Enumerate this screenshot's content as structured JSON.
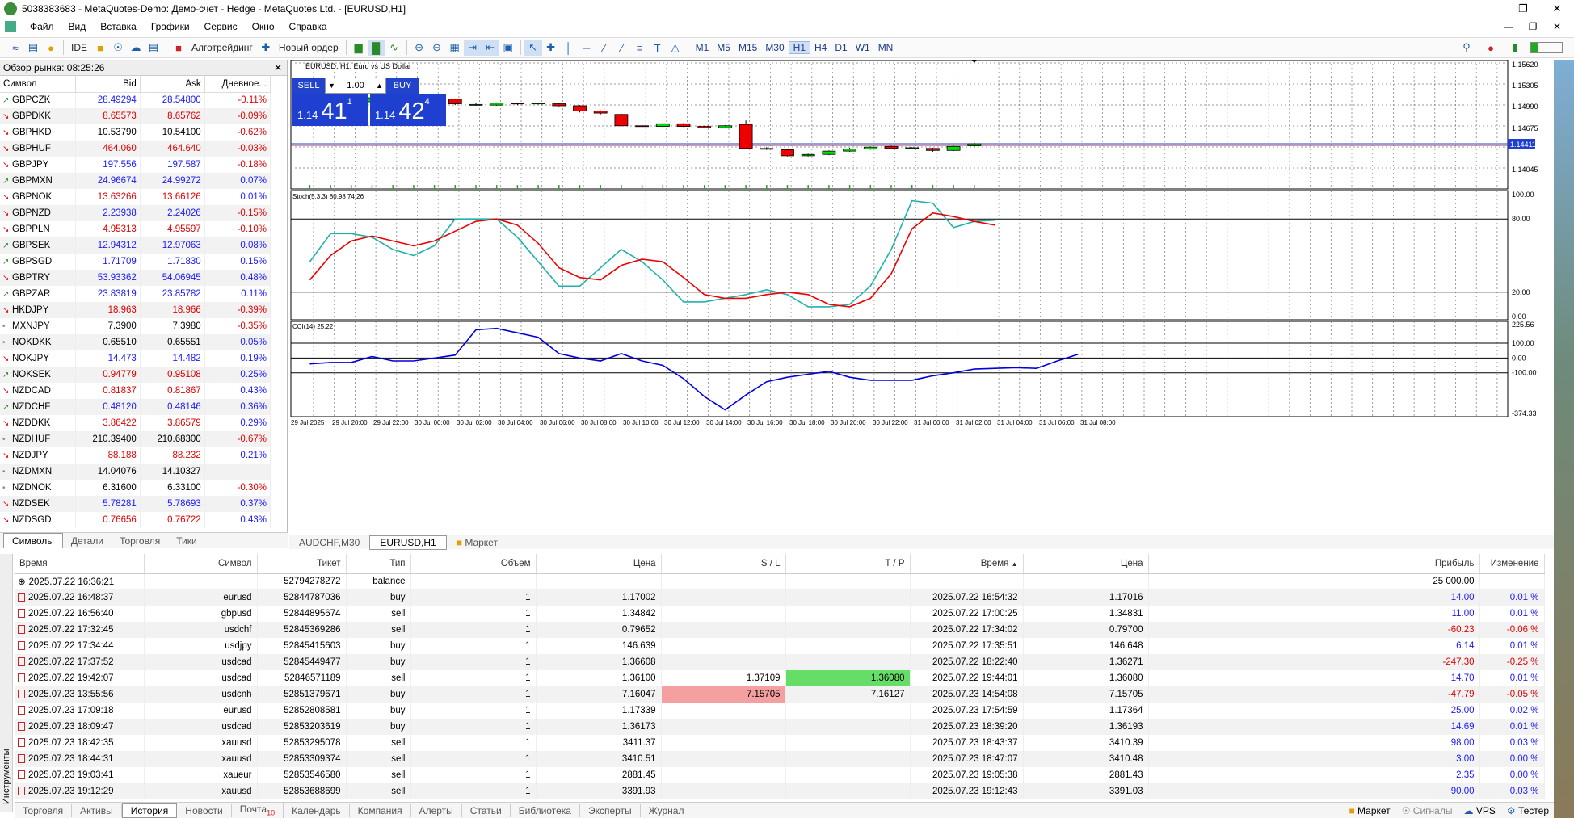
{
  "window": {
    "title": "5038383683 - MetaQuotes-Demo: Демо-счет - Hedge - MetaQuotes Ltd. - [EURUSD,H1]"
  },
  "menu": [
    "Файл",
    "Вид",
    "Вставка",
    "Графики",
    "Сервис",
    "Окно",
    "Справка"
  ],
  "toolbar": {
    "ide": "IDE",
    "algo": "Алготрейдинг",
    "new_order": "Новый ордер",
    "timeframes": [
      "M1",
      "M5",
      "M15",
      "M30",
      "H1",
      "H4",
      "D1",
      "W1",
      "MN"
    ],
    "active_tf": "H1"
  },
  "market_watch": {
    "title": "Обзор рынка: 08:25:26",
    "headers": [
      "Символ",
      "Bid",
      "Ask",
      "Дневное..."
    ],
    "rows": [
      {
        "s": "GBPCZK",
        "b": "28.49294",
        "a": "28.54800",
        "c": "-0.11%",
        "d": "up",
        "cd": "dn",
        "pc": "up"
      },
      {
        "s": "GBPDKK",
        "b": "8.65573",
        "a": "8.65762",
        "c": "-0.09%",
        "d": "dn",
        "cd": "dn",
        "pc": "dn"
      },
      {
        "s": "GBPHKD",
        "b": "10.53790",
        "a": "10.54100",
        "c": "-0.62%",
        "d": "dn",
        "cd": "dn",
        "pc": "neutral"
      },
      {
        "s": "GBPHUF",
        "b": "464.060",
        "a": "464.640",
        "c": "-0.03%",
        "d": "dn",
        "cd": "dn",
        "pc": "dn"
      },
      {
        "s": "GBPJPY",
        "b": "197.556",
        "a": "197.587",
        "c": "-0.18%",
        "d": "dn",
        "cd": "dn",
        "pc": "up"
      },
      {
        "s": "GBPMXN",
        "b": "24.96674",
        "a": "24.99272",
        "c": "0.07%",
        "d": "up",
        "cd": "up",
        "pc": "up"
      },
      {
        "s": "GBPNOK",
        "b": "13.63266",
        "a": "13.66126",
        "c": "0.01%",
        "d": "dn",
        "cd": "up",
        "pc": "dn"
      },
      {
        "s": "GBPNZD",
        "b": "2.23938",
        "a": "2.24026",
        "c": "-0.15%",
        "d": "dn",
        "cd": "dn",
        "pc": "up"
      },
      {
        "s": "GBPPLN",
        "b": "4.95313",
        "a": "4.95597",
        "c": "-0.10%",
        "d": "dn",
        "cd": "dn",
        "pc": "dn"
      },
      {
        "s": "GBPSEK",
        "b": "12.94312",
        "a": "12.97063",
        "c": "0.08%",
        "d": "up",
        "cd": "up",
        "pc": "up"
      },
      {
        "s": "GBPSGD",
        "b": "1.71709",
        "a": "1.71830",
        "c": "0.15%",
        "d": "up",
        "cd": "up",
        "pc": "up"
      },
      {
        "s": "GBPTRY",
        "b": "53.93362",
        "a": "54.06945",
        "c": "0.48%",
        "d": "dn",
        "cd": "up",
        "pc": "up"
      },
      {
        "s": "GBPZAR",
        "b": "23.83819",
        "a": "23.85782",
        "c": "0.11%",
        "d": "up",
        "cd": "up",
        "pc": "up"
      },
      {
        "s": "HKDJPY",
        "b": "18.963",
        "a": "18.966",
        "c": "-0.39%",
        "d": "dn",
        "cd": "dn",
        "pc": "dn"
      },
      {
        "s": "MXNJPY",
        "b": "7.3900",
        "a": "7.3980",
        "c": "-0.35%",
        "d": "none",
        "cd": "dn",
        "pc": "neutral"
      },
      {
        "s": "NOKDKK",
        "b": "0.65510",
        "a": "0.65551",
        "c": "0.05%",
        "d": "none",
        "cd": "up",
        "pc": "neutral"
      },
      {
        "s": "NOKJPY",
        "b": "14.473",
        "a": "14.482",
        "c": "0.19%",
        "d": "dn",
        "cd": "up",
        "pc": "up"
      },
      {
        "s": "NOKSEK",
        "b": "0.94779",
        "a": "0.95108",
        "c": "0.25%",
        "d": "up",
        "cd": "up",
        "pc": "dn"
      },
      {
        "s": "NZDCAD",
        "b": "0.81837",
        "a": "0.81867",
        "c": "0.43%",
        "d": "dn",
        "cd": "up",
        "pc": "dn"
      },
      {
        "s": "NZDCHF",
        "b": "0.48120",
        "a": "0.48146",
        "c": "0.36%",
        "d": "up",
        "cd": "up",
        "pc": "up"
      },
      {
        "s": "NZDDKK",
        "b": "3.86422",
        "a": "3.86579",
        "c": "0.29%",
        "d": "dn",
        "cd": "up",
        "pc": "dn"
      },
      {
        "s": "NZDHUF",
        "b": "210.39400",
        "a": "210.68300",
        "c": "-0.67%",
        "d": "none",
        "cd": "dn",
        "pc": "neutral"
      },
      {
        "s": "NZDJPY",
        "b": "88.188",
        "a": "88.232",
        "c": "0.21%",
        "d": "dn",
        "cd": "up",
        "pc": "dn"
      },
      {
        "s": "NZDMXN",
        "b": "14.04076",
        "a": "14.10327",
        "c": "",
        "d": "none",
        "cd": "up",
        "pc": "neutral"
      },
      {
        "s": "NZDNOK",
        "b": "6.31600",
        "a": "6.33100",
        "c": "-0.30%",
        "d": "none",
        "cd": "dn",
        "pc": "neutral"
      },
      {
        "s": "NZDSEK",
        "b": "5.78281",
        "a": "5.78693",
        "c": "0.37%",
        "d": "dn",
        "cd": "up",
        "pc": "up"
      },
      {
        "s": "NZDSGD",
        "b": "0.76656",
        "a": "0.76722",
        "c": "0.43%",
        "d": "dn",
        "cd": "up",
        "pc": "dn"
      }
    ],
    "tabs": [
      "Символы",
      "Детали",
      "Торговля",
      "Тики"
    ]
  },
  "chart": {
    "title": "EURUSD, H1:  Euro vs US Dollar",
    "sell": "SELL",
    "buy": "BUY",
    "volume": "1.00",
    "sell_price": {
      "small": "1.14",
      "big": "41",
      "sup": "1"
    },
    "buy_price": {
      "small": "1.14",
      "big": "42",
      "sup": "4"
    },
    "price_axis": [
      "1.15620",
      "1.15305",
      "1.14990",
      "1.14675",
      "1.14411",
      "1.14045"
    ],
    "stoch_label": "Stoch(5,3,3) 80.98 74.26",
    "stoch_axis": [
      "100.00",
      "80.00",
      "20.00",
      "0.00"
    ],
    "cci_label": "CCI(14) 25.22",
    "cci_axis": [
      "225.56",
      "100.00",
      "0.00",
      "-100.00",
      "-374.33"
    ],
    "time_axis": [
      "29 Jul 2025",
      "29 Jul 20:00",
      "29 Jul 22:00",
      "30 Jul 00:00",
      "30 Jul 02:00",
      "30 Jul 04:00",
      "30 Jul 06:00",
      "30 Jul 08:00",
      "30 Jul 10:00",
      "30 Jul 12:00",
      "30 Jul 14:00",
      "30 Jul 16:00",
      "30 Jul 18:00",
      "30 Jul 20:00",
      "30 Jul 22:00",
      "31 Jul 00:00",
      "31 Jul 02:00",
      "31 Jul 04:00",
      "31 Jul 06:00",
      "31 Jul 08:00"
    ],
    "tabs": [
      "AUDCHF,M30",
      "EURUSD,H1",
      "Маркет"
    ]
  },
  "history": {
    "headers": [
      "Время",
      "Символ",
      "Тикет",
      "Тип",
      "Объем",
      "Цена",
      "S / L",
      "T / P",
      "Время",
      "Цена",
      "Прибыль",
      "Изменение"
    ],
    "rows": [
      {
        "t": "2025.07.22 16:36:21",
        "s": "",
        "k": "52794278272",
        "ty": "balance",
        "v": "",
        "p": "",
        "sl": "",
        "tp": "",
        "t2": "",
        "p2": "",
        "pr": "25 000.00",
        "ch": "",
        "bal": true
      },
      {
        "t": "2025.07.22 16:48:37",
        "s": "eurusd",
        "k": "52844787036",
        "ty": "buy",
        "v": "1",
        "p": "1.17002",
        "sl": "",
        "tp": "",
        "t2": "2025.07.22 16:54:32",
        "p2": "1.17016",
        "pr": "14.00",
        "ch": "0.01 %"
      },
      {
        "t": "2025.07.22 16:56:40",
        "s": "gbpusd",
        "k": "52844895674",
        "ty": "sell",
        "v": "1",
        "p": "1.34842",
        "sl": "",
        "tp": "",
        "t2": "2025.07.22 17:00:25",
        "p2": "1.34831",
        "pr": "11.00",
        "ch": "0.01 %"
      },
      {
        "t": "2025.07.22 17:32:45",
        "s": "usdchf",
        "k": "52845369286",
        "ty": "sell",
        "v": "1",
        "p": "0.79652",
        "sl": "",
        "tp": "",
        "t2": "2025.07.22 17:34:02",
        "p2": "0.79700",
        "pr": "-60.23",
        "ch": "-0.06 %"
      },
      {
        "t": "2025.07.22 17:34:44",
        "s": "usdjpy",
        "k": "52845415603",
        "ty": "buy",
        "v": "1",
        "p": "146.639",
        "sl": "",
        "tp": "",
        "t2": "2025.07.22 17:35:51",
        "p2": "146.648",
        "pr": "6.14",
        "ch": "0.01 %"
      },
      {
        "t": "2025.07.22 17:37:52",
        "s": "usdcad",
        "k": "52845449477",
        "ty": "buy",
        "v": "1",
        "p": "1.36608",
        "sl": "",
        "tp": "",
        "t2": "2025.07.22 18:22:40",
        "p2": "1.36271",
        "pr": "-247.30",
        "ch": "-0.25 %"
      },
      {
        "t": "2025.07.22 19:42:07",
        "s": "usdcad",
        "k": "52846571189",
        "ty": "sell",
        "v": "1",
        "p": "1.36100",
        "sl": "1.37109",
        "tp": "1.36080",
        "t2": "2025.07.22 19:44:01",
        "p2": "1.36080",
        "pr": "14.70",
        "ch": "0.01 %",
        "tpg": true
      },
      {
        "t": "2025.07.23 13:55:56",
        "s": "usdcnh",
        "k": "52851379671",
        "ty": "buy",
        "v": "1",
        "p": "7.16047",
        "sl": "7.15705",
        "tp": "7.16127",
        "t2": "2025.07.23 14:54:08",
        "p2": "7.15705",
        "pr": "-47.79",
        "ch": "-0.05 %",
        "slr": true
      },
      {
        "t": "2025.07.23 17:09:18",
        "s": "eurusd",
        "k": "52852808581",
        "ty": "buy",
        "v": "1",
        "p": "1.17339",
        "sl": "",
        "tp": "",
        "t2": "2025.07.23 17:54:59",
        "p2": "1.17364",
        "pr": "25.00",
        "ch": "0.02 %"
      },
      {
        "t": "2025.07.23 18:09:47",
        "s": "usdcad",
        "k": "52853203619",
        "ty": "buy",
        "v": "1",
        "p": "1.36173",
        "sl": "",
        "tp": "",
        "t2": "2025.07.23 18:39:20",
        "p2": "1.36193",
        "pr": "14.69",
        "ch": "0.01 %"
      },
      {
        "t": "2025.07.23 18:42:35",
        "s": "xauusd",
        "k": "52853295078",
        "ty": "sell",
        "v": "1",
        "p": "3411.37",
        "sl": "",
        "tp": "",
        "t2": "2025.07.23 18:43:37",
        "p2": "3410.39",
        "pr": "98.00",
        "ch": "0.03 %"
      },
      {
        "t": "2025.07.23 18:44:31",
        "s": "xauusd",
        "k": "52853309374",
        "ty": "sell",
        "v": "1",
        "p": "3410.51",
        "sl": "",
        "tp": "",
        "t2": "2025.07.23 18:47:07",
        "p2": "3410.48",
        "pr": "3.00",
        "ch": "0.00 %"
      },
      {
        "t": "2025.07.23 19:03:41",
        "s": "xaueur",
        "k": "52853546580",
        "ty": "sell",
        "v": "1",
        "p": "2881.45",
        "sl": "",
        "tp": "",
        "t2": "2025.07.23 19:05:38",
        "p2": "2881.43",
        "pr": "2.35",
        "ch": "0.00 %"
      },
      {
        "t": "2025.07.23 19:12:29",
        "s": "xauusd",
        "k": "52853688699",
        "ty": "sell",
        "v": "1",
        "p": "3391.93",
        "sl": "",
        "tp": "",
        "t2": "2025.07.23 19:12:43",
        "p2": "3391.03",
        "pr": "90.00",
        "ch": "0.03 %"
      }
    ],
    "side_label": "Инструменты",
    "tabs": [
      "Торговля",
      "Активы",
      "История",
      "Новости",
      "Почта",
      "Календарь",
      "Компания",
      "Алерты",
      "Статьи",
      "Библиотека",
      "Эксперты",
      "Журнал"
    ],
    "mail_count": "10",
    "right_items": [
      "Маркет",
      "Сигналы",
      "VPS",
      "Тестер"
    ]
  }
}
